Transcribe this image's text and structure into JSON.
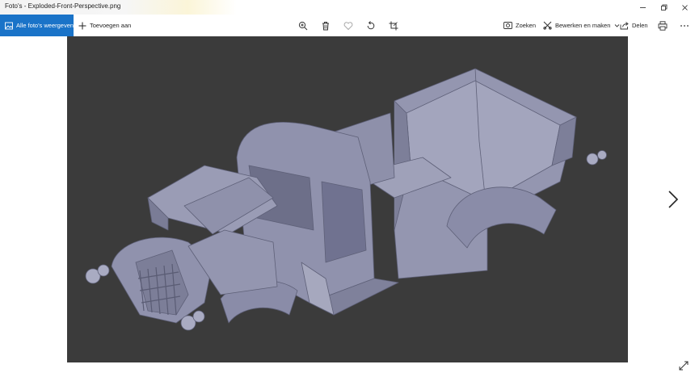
{
  "window": {
    "title": "Foto's - Exploded-Front-Perspective.png",
    "controls": [
      "minimize-icon",
      "restore-icon",
      "close-icon"
    ]
  },
  "toolbar": {
    "all_photos_label": "Alle foto's weergeven",
    "add_label": "Toevoegen aan",
    "center_icons": [
      "zoom-icon",
      "delete-icon",
      "favorite-icon",
      "rotate-icon",
      "crop-icon"
    ],
    "search_label": "Zoeken",
    "edit_label": "Bewerken en maken",
    "share_label": "Delen",
    "more_icon": "more-icon",
    "print_icon": "print-icon"
  },
  "viewer": {
    "image_icon": "truck-model-image",
    "next_icon": "chevron-right-icon",
    "expand_icon": "expand-icon"
  },
  "colors": {
    "accent": "#1a73c8",
    "viewer_bg": "#3b3b3b",
    "model": "#8a8ca8"
  }
}
